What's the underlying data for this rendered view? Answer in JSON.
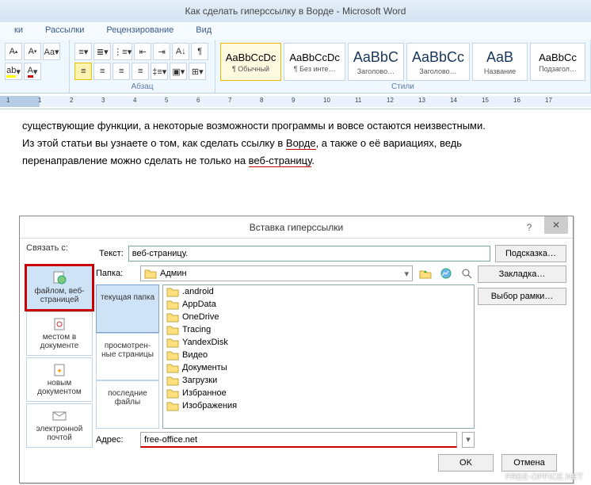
{
  "window": {
    "title": "Как сделать гиперссылку в Ворде - Microsoft Word"
  },
  "tabs": {
    "t0": "ки",
    "t1": "Рассылки",
    "t2": "Рецензирование",
    "t3": "Вид"
  },
  "ribbon": {
    "para_label": "Абзац",
    "styles_label": "Стили",
    "styles": [
      {
        "sample": "AaBbCcDc",
        "name": "¶ Обычный"
      },
      {
        "sample": "AaBbCcDc",
        "name": "¶ Без инте…"
      },
      {
        "sample": "AaBbC",
        "name": "Заголово…"
      },
      {
        "sample": "AaBbCc",
        "name": "Заголово…"
      },
      {
        "sample": "AaB",
        "name": "Название"
      },
      {
        "sample": "AaBbCc",
        "name": "Подзагол…"
      }
    ]
  },
  "ruler_nums": [
    "1",
    "1",
    "2",
    "3",
    "4",
    "5",
    "6",
    "7",
    "8",
    "9",
    "10",
    "11",
    "12",
    "13",
    "14",
    "15",
    "16",
    "17"
  ],
  "doc": {
    "l1a": "существующие функции, а некоторые возможности программы и вовсе остаются неизвестными.",
    "l2a": "Из этой статьи вы узнаете о том, как сделать ссылку в ",
    "l2u": "Ворде",
    "l2b": ", а также о её вариациях, ведь",
    "l3a": "перенаправление можно сделать не только на ",
    "l3u": "веб-страницу",
    "l3b": "."
  },
  "dlg": {
    "title": "Вставка гиперссылки",
    "link_to": "Связать с:",
    "text_label": "Текст:",
    "text_value": "веб-страницу.",
    "tooltip_btn": "Подсказка…",
    "folder_label": "Папка:",
    "folder_value": "Админ",
    "addr_label": "Адрес:",
    "addr_value": "free-office.net",
    "bookmark_btn": "Закладка…",
    "frame_btn": "Выбор рамки…",
    "ok": "OK",
    "cancel": "Отмена",
    "ltabs": {
      "file": "файлом, веб-страницей",
      "place": "местом в документе",
      "newdoc": "новым документом",
      "email": "электронной почтой"
    },
    "btabs": {
      "cur": "текущая папка",
      "viewed": "просмотрен-ные страницы",
      "recent": "последние файлы"
    },
    "files": [
      ".android",
      "AppData",
      "OneDrive",
      "Tracing",
      "YandexDisk",
      "Видео",
      "Документы",
      "Загрузки",
      "Избранное",
      "Изображения"
    ]
  },
  "watermark": "FREE-OFFICE.NET"
}
